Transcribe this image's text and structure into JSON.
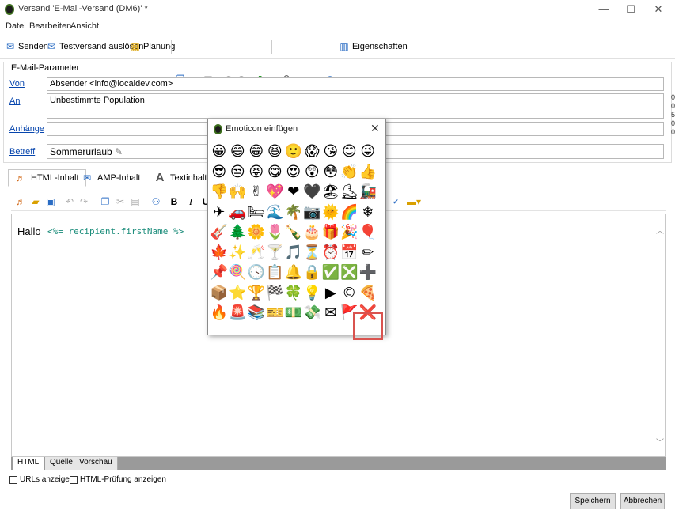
{
  "window": {
    "title": "Versand 'E-Mail-Versand (DM6)' *",
    "minimize": "—",
    "maximize": "☐",
    "close": "✕"
  },
  "menu": [
    "Datei",
    "Bearbeiten",
    "Ansicht"
  ],
  "toolbar": {
    "send_label": "Senden",
    "test_label": "Testversand auslösen",
    "plan_label": "Planung",
    "props_label": "Eigenschaften"
  },
  "params": {
    "section_title": "E-Mail-Parameter",
    "from_label": "Von",
    "from_value": "Absender <info@localdev.com>",
    "to_label": "An",
    "to_value": "Unbestimmte Population",
    "attachments_label": "Anhänge",
    "attachments_value": "",
    "subject_label": "Betreff",
    "subject_value": "Sommerurlaub"
  },
  "content_tabs": [
    "HTML-Inhalt",
    "AMP-Inhalt",
    "Textinhalt"
  ],
  "editor": {
    "bold": "B",
    "italic": "I",
    "greeting": "Hallo",
    "code": "<%= recipient.firstName %>"
  },
  "bottom_tabs": [
    "HTML",
    "Quelle",
    "Vorschau"
  ],
  "checkboxes": {
    "urls": "URLs anzeigen",
    "html_check": "HTML-Prüfung anzeigen"
  },
  "buttons": {
    "save": "Speichern",
    "cancel": "Abbrechen"
  },
  "dialog": {
    "title": "Emoticon einfügen",
    "close": "✕",
    "emoticons": [
      "😀",
      "😄",
      "😁",
      "😆",
      "🙂",
      "😱",
      "😘",
      "😊",
      "😜",
      "😎",
      "😒",
      "😝",
      "😋",
      "😍",
      "😲",
      "😳",
      "👏",
      "👍",
      "👎",
      "🙌",
      "✌",
      "💖",
      "❤",
      "🖤",
      "🏖",
      "⛸",
      "🚂",
      "✈",
      "🚗",
      "🛏",
      "🌊",
      "🌴",
      "📷",
      "🌞",
      "🌈",
      "❄",
      "🎸",
      "🌲",
      "🌼",
      "🌷",
      "🍾",
      "🎂",
      "🎁",
      "🎉",
      "🎈",
      "🍁",
      "✨",
      "🥂",
      "🍸",
      "🎵",
      "⏳",
      "⏰",
      "📅",
      "✏",
      "📌",
      "🍭",
      "🕓",
      "📋",
      "🔔",
      "🔒",
      "✅",
      "❎",
      "➕",
      "📦",
      "⭐",
      "🏆",
      "🏁",
      "🍀",
      "💡",
      "▶",
      "©",
      "🍕",
      "🔥",
      "🚨",
      "📚",
      "🎫",
      "💵",
      "💸",
      "✉",
      "🚩",
      "❌"
    ]
  }
}
